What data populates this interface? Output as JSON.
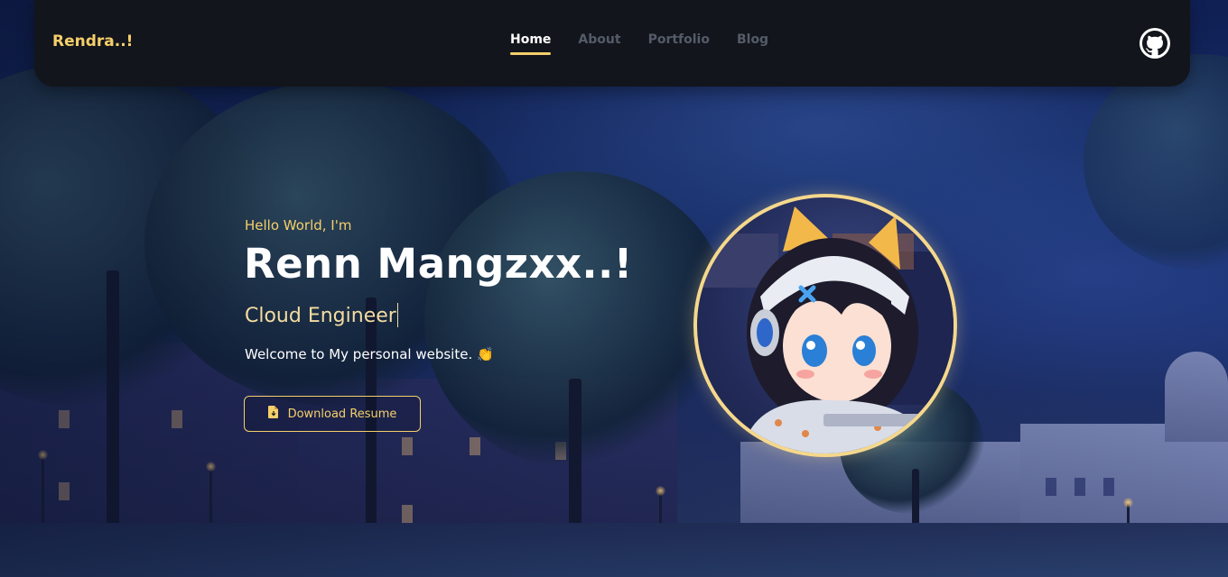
{
  "nav": {
    "brand": "Rendra..!",
    "links": [
      "Home",
      "About",
      "Portfolio",
      "Blog"
    ],
    "active_link": "Home",
    "github_icon": "github-icon"
  },
  "hero": {
    "greeting": "Hello World, I'm",
    "name": "Renn Mangzxx..!",
    "role": "Cloud Engineer",
    "welcome": "Welcome to My personal website. 👏",
    "resume_button": "Download Resume",
    "resume_icon": "file-download-icon"
  },
  "avatar": {
    "icon": "anime-girl-avatar"
  },
  "colors": {
    "accent": "#f5cf6b",
    "nav_bg": "#13151c",
    "nav_inactive": "#545b69",
    "text": "#ffffff"
  }
}
